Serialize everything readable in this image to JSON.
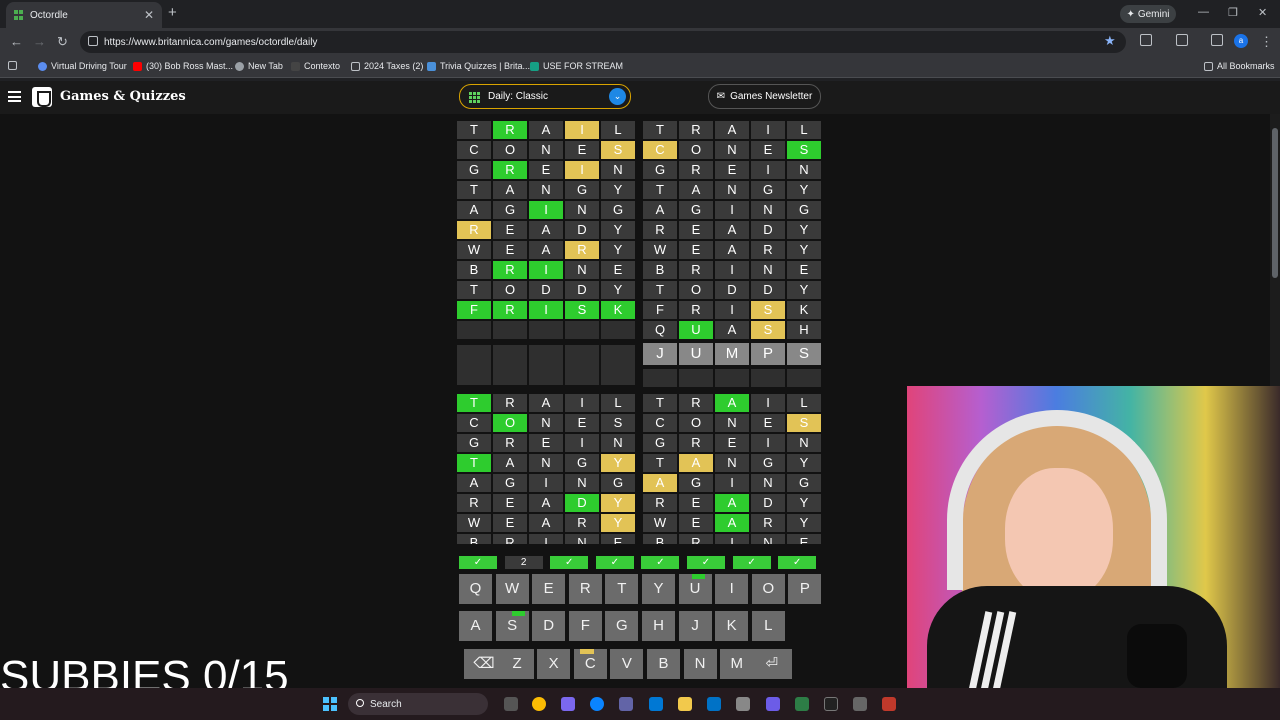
{
  "browser": {
    "tab_title": "Octordle",
    "close_glyph": "✕",
    "newtab_glyph": "+",
    "gemini_label": "Gemini",
    "url": "https://www.britannica.com/games/octordle/daily",
    "back_glyph": "←",
    "forward_glyph": "→",
    "reload_glyph": "↻",
    "star_glyph": "★",
    "profile_letter": "a",
    "window_controls": [
      "—",
      "❐",
      "✕"
    ],
    "bookmarks": [
      {
        "label": "Virtual Driving Tour",
        "color": "#5b8def"
      },
      {
        "label": "(30) Bob Ross Mast...",
        "color": "#ff0000"
      },
      {
        "label": "New Tab",
        "color": "#9aa0a6"
      },
      {
        "label": "Contexto",
        "color": "#444444"
      },
      {
        "label": "2024 Taxes (2)",
        "color": "#9aa0a6"
      },
      {
        "label": "Trivia Quizzes | Brita...",
        "color": "#4a90d9"
      },
      {
        "label": "USE FOR STREAM",
        "color": "#16a085"
      }
    ],
    "all_bookmarks": "All Bookmarks"
  },
  "site": {
    "title": "Games & Quizzes",
    "mode": "Daily: Classic",
    "newsletter": "Games Newsletter"
  },
  "colors": {
    "green": "#2ecc2e",
    "yellow": "#e2c356",
    "gray": "#3a3a3a",
    "key": "#6b6b6b"
  },
  "boards": [
    {
      "rows": [
        "TRAIL:.g.y.",
        "CONES:....y",
        "GREIN:.g.y.",
        "TANGY:.....",
        "AGING:..g..",
        "READY:y....",
        "WEARY:...y.",
        "BRINE:.gg..",
        "TODDY:.....",
        "FRISK:ggggg"
      ],
      "blank_rows": 3,
      "preview": "",
      "preview_row": null
    },
    {
      "rows": [
        "TRAIL:.....",
        "CONES:y...g",
        "GREIN:.....",
        "TANGY:.....",
        "AGING:.....",
        "READY:.....",
        "WEARY:.....",
        "BRINE:.....",
        "TODDY:.....",
        "FRISK:...y.",
        "QUASH:.g.y."
      ],
      "blank_rows": 1,
      "preview": "JUMPS",
      "preview_row": 11
    },
    {
      "rows": [
        "TRAIL:g....",
        "CONES:.g...",
        "GREIN:.....",
        "TANGY:g...y",
        "AGING:.....",
        "READY:...gy",
        "WEARY:....y",
        "BRINE:....."
      ],
      "blank_rows": 0,
      "preview": "",
      "preview_row": null
    },
    {
      "rows": [
        "TRAIL:..g..",
        "CONES:....y",
        "GREIN:.....",
        "TANGY:.y...",
        "AGING:y....",
        "READY:..g..",
        "WEARY:..g..",
        "BRINE:....."
      ],
      "blank_rows": 0,
      "preview": "",
      "preview_row": null
    }
  ],
  "status_bar": [
    "✓",
    "2",
    "✓",
    "✓",
    "✓",
    "✓",
    "✓",
    "✓"
  ],
  "keyboard": [
    [
      "Q",
      "W",
      "E",
      "R",
      "T",
      "Y",
      "U",
      "I",
      "O",
      "P"
    ],
    [
      "A",
      "S",
      "D",
      "F",
      "G",
      "H",
      "J",
      "K",
      "L"
    ],
    [
      "⌫",
      "Z",
      "X",
      "C",
      "V",
      "B",
      "N",
      "M",
      "⏎"
    ]
  ],
  "overlay_text": "SUBBIES 0/15",
  "taskbar": {
    "search": "Search"
  }
}
